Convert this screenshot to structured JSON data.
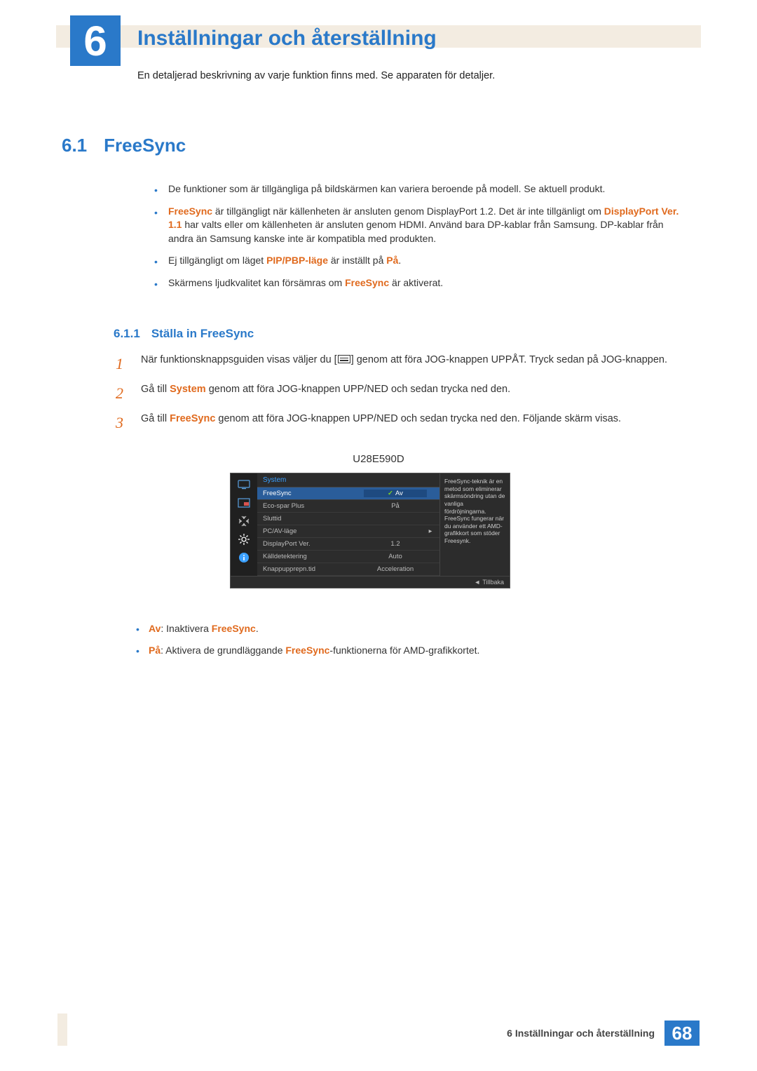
{
  "chapter": {
    "num": "6",
    "title": "Inställningar och återställning",
    "desc": "En detaljerad beskrivning av varje funktion finns med. Se apparaten för detaljer."
  },
  "section": {
    "num": "6.1",
    "title": "FreeSync"
  },
  "notes": {
    "n1": "De funktioner som är tillgängliga på bildskärmen kan variera beroende på modell. Se aktuell produkt.",
    "n2a": "FreeSync",
    "n2b": " är tillgängligt när källenheten är ansluten genom DisplayPort 1.2. Det är inte tillgänligt om ",
    "n2c": "DisplayPort Ver. 1.1",
    "n2d": " har valts eller om källenheten är ansluten genom HDMI. Använd bara DP-kablar från Samsung. DP-kablar från andra än Samsung kanske inte är kompatibla med produkten.",
    "n3a": "Ej tillgängligt om läget ",
    "n3b": "PIP/PBP-läge",
    "n3c": " är inställt på ",
    "n3d": "På",
    "n3e": ".",
    "n4a": "Skärmens ljudkvalitet kan försämras om ",
    "n4b": "FreeSync",
    "n4c": " är aktiverat."
  },
  "subsection": {
    "num": "6.1.1",
    "title": "Ställa in FreeSync"
  },
  "steps": {
    "s1n": "1",
    "s1a": "När funktionsknappsguiden visas väljer du [",
    "s1b": "] genom att föra JOG-knappen UPPÅT. Tryck sedan på JOG-knappen.",
    "s2n": "2",
    "s2a": "Gå till ",
    "s2b": "System",
    "s2c": " genom att föra JOG-knappen UPP/NED och sedan trycka ned den.",
    "s3n": "3",
    "s3a": "Gå till ",
    "s3b": "FreeSync",
    "s3c": " genom att föra JOG-knappen UPP/NED och sedan trycka ned den. Följande skärm visas."
  },
  "model": "U28E590D",
  "osd": {
    "header": "System",
    "rows": [
      {
        "label": "FreeSync",
        "val": "Av",
        "sel": true,
        "check": true
      },
      {
        "label": "Eco-spar Plus",
        "val": "På"
      },
      {
        "label": "Sluttid",
        "val": ""
      },
      {
        "label": "PC/AV-läge",
        "val": "",
        "arrow": true
      },
      {
        "label": "DisplayPort Ver.",
        "val": "1.2"
      },
      {
        "label": "Källdetektering",
        "val": "Auto"
      },
      {
        "label": "Knappupprepn.tid",
        "val": "Acceleration"
      }
    ],
    "side": "FreeSync-teknik är en metod som eliminerar skärmsöndring utan de vanliga fördröjningarna. FreeSync fungerar när du använder ett AMD-grafikkort som stöder Freesynk.",
    "footer": "Tillbaka"
  },
  "options": {
    "o1a": "Av",
    "o1b": ": Inaktivera ",
    "o1c": "FreeSync",
    "o1d": ".",
    "o2a": "På",
    "o2b": ": Aktivera de grundläggande ",
    "o2c": "FreeSync",
    "o2d": "-funktionerna för AMD-grafikkortet."
  },
  "footer": {
    "text": "6 Inställningar och återställning",
    "page": "68"
  }
}
